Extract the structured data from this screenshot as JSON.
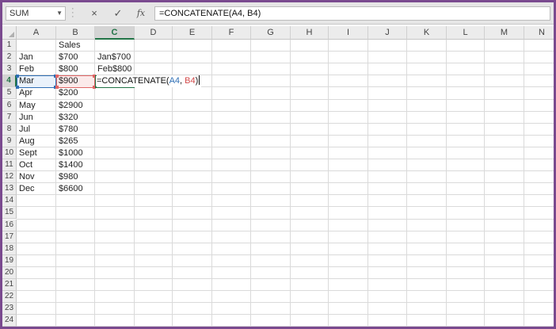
{
  "name_box": {
    "value": "SUM"
  },
  "formula_bar": {
    "cancel_icon": "×",
    "enter_icon": "✓",
    "fx_label": "fx",
    "formula": "=CONCATENATE(A4, B4)"
  },
  "columns": [
    "A",
    "B",
    "C",
    "D",
    "E",
    "F",
    "G",
    "H",
    "I",
    "J",
    "K",
    "L",
    "M",
    "N"
  ],
  "active_column": "C",
  "rows": [
    "1",
    "2",
    "3",
    "4",
    "5",
    "6",
    "7",
    "8",
    "9",
    "10",
    "11",
    "12",
    "13",
    "14",
    "15",
    "16",
    "17",
    "18",
    "19",
    "20",
    "21",
    "22",
    "23",
    "24"
  ],
  "active_row": "4",
  "sheet": {
    "header_sales": "Sales",
    "data": [
      {
        "row": "2",
        "a": "Jan",
        "b": "$700",
        "c": "Jan$700"
      },
      {
        "row": "3",
        "a": "Feb",
        "b": "$800",
        "c": "Feb$800"
      },
      {
        "row": "4",
        "a": "Mar",
        "b": "$900",
        "c": ""
      },
      {
        "row": "5",
        "a": "Apr",
        "b": "$200",
        "c": ""
      },
      {
        "row": "6",
        "a": "May",
        "b": "$2900",
        "c": ""
      },
      {
        "row": "7",
        "a": "Jun",
        "b": "$320",
        "c": ""
      },
      {
        "row": "8",
        "a": "Jul",
        "b": "$780",
        "c": ""
      },
      {
        "row": "9",
        "a": "Aug",
        "b": "$265",
        "c": ""
      },
      {
        "row": "10",
        "a": "Sept",
        "b": "$1000",
        "c": ""
      },
      {
        "row": "11",
        "a": "Oct",
        "b": "$1400",
        "c": ""
      },
      {
        "row": "12",
        "a": "Nov",
        "b": "$980",
        "c": ""
      },
      {
        "row": "13",
        "a": "Dec",
        "b": "$6600",
        "c": ""
      }
    ]
  },
  "edit_cell": {
    "prefix": "=CONCATENATE(",
    "ref1": "A4",
    "comma": ", ",
    "ref2": "B4",
    "suffix": ")"
  },
  "colors": {
    "accent": "#217346",
    "ref_a4": "#2f6fb5",
    "ref_b4": "#e06666",
    "window_border": "#7a4a8f"
  }
}
